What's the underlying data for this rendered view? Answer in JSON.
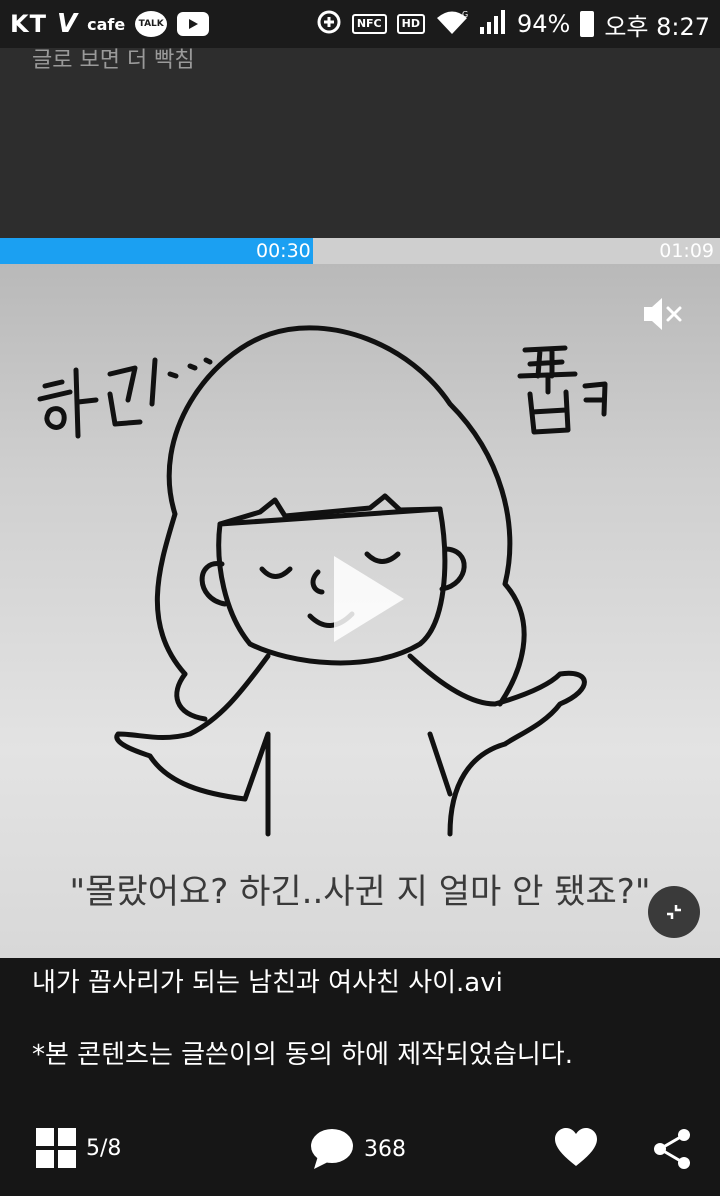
{
  "status_bar": {
    "carrier": "KT",
    "cafe_label": "cafe",
    "talk_label": "TALK",
    "nfc_label": "NFC",
    "hd_label": "HD",
    "signal_label": "G",
    "battery": "94%",
    "time": "오후 8:27",
    "icons": [
      "v-logo-icon",
      "cafe-icon",
      "kakaotalk-icon",
      "youtube-icon",
      "data-saver-icon",
      "nfc-icon",
      "hd-icon",
      "wifi-icon",
      "signal-icon",
      "battery-icon"
    ]
  },
  "top_caption": "글로 보면 더 빡침",
  "player": {
    "current_time": "00:30",
    "total_time": "01:09",
    "progress": 0.435,
    "accent_color": "#1ba0f2",
    "muted": true,
    "subtitle": "\"몰랐어요? 하긴..사귄 지 얼마 안 됐죠?\"",
    "drawing_text_left": "하긴...",
    "drawing_text_right": "풉ㅋ"
  },
  "post": {
    "title": "내가 꼽사리가 되는 남친과 여사친 사이.avi",
    "description": "*본 콘텐츠는 글쓴이의 동의 하에 제작되었습니다."
  },
  "bottom_bar": {
    "page_indicator": "5/8",
    "comment_count": "368"
  }
}
